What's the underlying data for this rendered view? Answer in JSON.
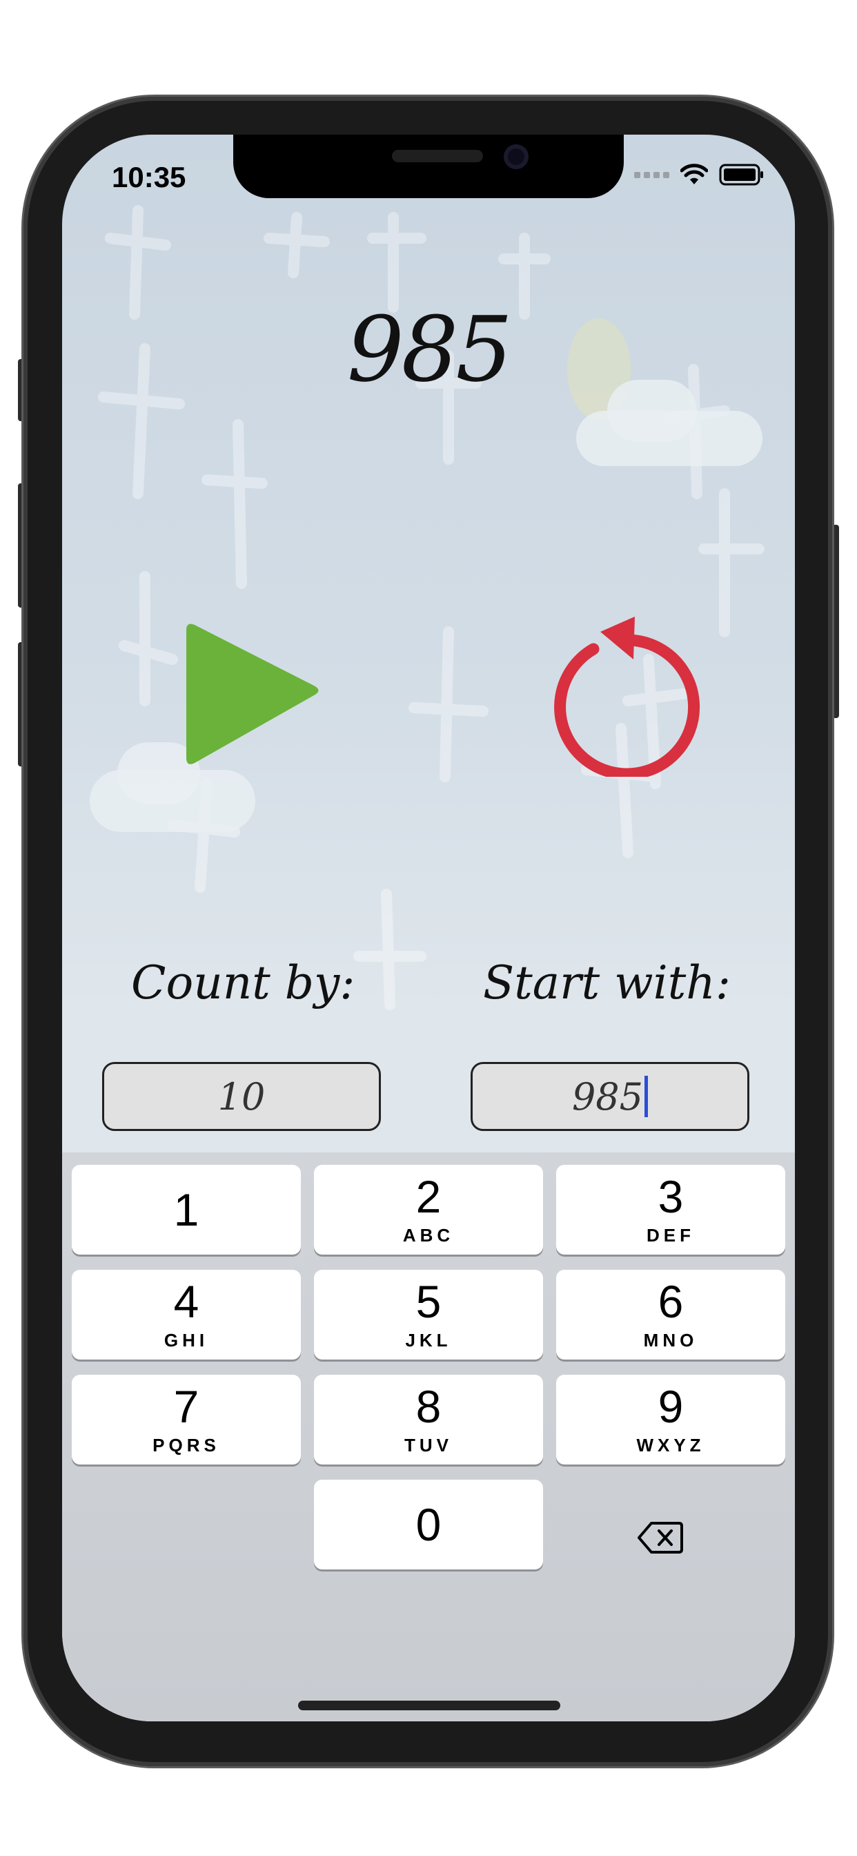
{
  "status_bar": {
    "time": "10:35"
  },
  "counter": {
    "value": "985"
  },
  "controls": {
    "play_icon": "play-icon",
    "reset_icon": "reset-icon"
  },
  "labels": {
    "count_by": "Count by:",
    "start_with": "Start with:"
  },
  "fields": {
    "count_by_value": "10",
    "start_with_value": "985"
  },
  "keyboard": {
    "keys": [
      {
        "digit": "1",
        "letters": ""
      },
      {
        "digit": "2",
        "letters": "ABC"
      },
      {
        "digit": "3",
        "letters": "DEF"
      },
      {
        "digit": "4",
        "letters": "GHI"
      },
      {
        "digit": "5",
        "letters": "JKL"
      },
      {
        "digit": "6",
        "letters": "MNO"
      },
      {
        "digit": "7",
        "letters": "PQRS"
      },
      {
        "digit": "8",
        "letters": "TUV"
      },
      {
        "digit": "9",
        "letters": "WXYZ"
      },
      {
        "digit": "0",
        "letters": ""
      }
    ],
    "delete_icon": "backspace-icon"
  },
  "colors": {
    "play": "#6ab23a",
    "reset": "#d8303f",
    "caret": "#2b4dd6"
  }
}
